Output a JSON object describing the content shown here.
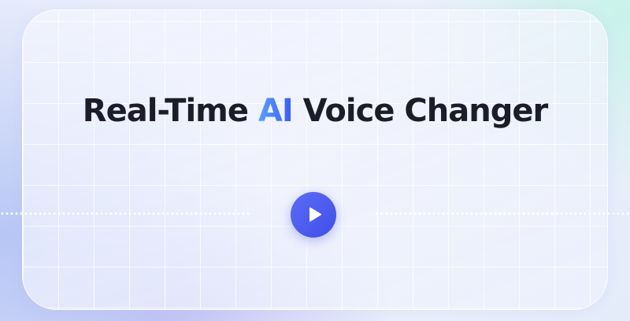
{
  "headline": {
    "before": "Real-Time ",
    "accent": "AI",
    "after": " Voice Changer"
  },
  "play_button": {
    "icon": "play-icon"
  },
  "colors": {
    "accent": "#3d7cf5",
    "button": "#4a5cf0",
    "text": "#1c1c2b"
  }
}
